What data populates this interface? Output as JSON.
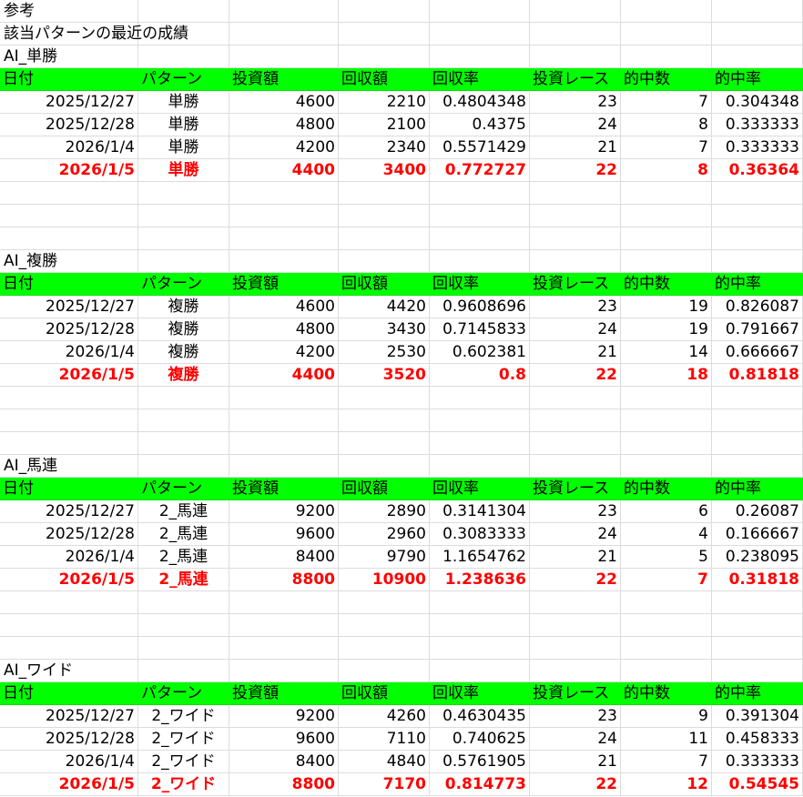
{
  "note": {
    "line1": "参考",
    "line2": "該当パターンの最近の成績"
  },
  "columns": [
    "日付",
    "パターン",
    "投資額",
    "回収額",
    "回収率",
    "投資レース",
    "的中数",
    "的中率"
  ],
  "sections": [
    {
      "title": "AI_単勝",
      "rows": [
        [
          "2025/12/27",
          "単勝",
          "4600",
          "2210",
          "0.4804348",
          "23",
          "7",
          "0.304348"
        ],
        [
          "2025/12/28",
          "単勝",
          "4800",
          "2100",
          "0.4375",
          "24",
          "8",
          "0.333333"
        ],
        [
          "2026/1/4",
          "単勝",
          "4200",
          "2340",
          "0.5571429",
          "21",
          "7",
          "0.333333"
        ],
        [
          "2026/1/5",
          "単勝",
          "4400",
          "3400",
          "0.772727",
          "22",
          "8",
          "0.36364"
        ]
      ]
    },
    {
      "title": "AI_複勝",
      "rows": [
        [
          "2025/12/27",
          "複勝",
          "4600",
          "4420",
          "0.9608696",
          "23",
          "19",
          "0.826087"
        ],
        [
          "2025/12/28",
          "複勝",
          "4800",
          "3430",
          "0.7145833",
          "24",
          "19",
          "0.791667"
        ],
        [
          "2026/1/4",
          "複勝",
          "4200",
          "2530",
          "0.602381",
          "21",
          "14",
          "0.666667"
        ],
        [
          "2026/1/5",
          "複勝",
          "4400",
          "3520",
          "0.8",
          "22",
          "18",
          "0.81818"
        ]
      ]
    },
    {
      "title": "AI_馬連",
      "rows": [
        [
          "2025/12/27",
          "2_馬連",
          "9200",
          "2890",
          "0.3141304",
          "23",
          "6",
          "0.26087"
        ],
        [
          "2025/12/28",
          "2_馬連",
          "9600",
          "2960",
          "0.3083333",
          "24",
          "4",
          "0.166667"
        ],
        [
          "2026/1/4",
          "2_馬連",
          "8400",
          "9790",
          "1.1654762",
          "21",
          "5",
          "0.238095"
        ],
        [
          "2026/1/5",
          "2_馬連",
          "8800",
          "10900",
          "1.238636",
          "22",
          "7",
          "0.31818"
        ]
      ]
    },
    {
      "title": "AI_ワイド",
      "rows": [
        [
          "2025/12/27",
          "2_ワイド",
          "9200",
          "4260",
          "0.4630435",
          "23",
          "9",
          "0.391304"
        ],
        [
          "2025/12/28",
          "2_ワイド",
          "9600",
          "7110",
          "0.740625",
          "24",
          "11",
          "0.458333"
        ],
        [
          "2026/1/4",
          "2_ワイド",
          "8400",
          "4840",
          "0.5761905",
          "21",
          "7",
          "0.333333"
        ],
        [
          "2026/1/5",
          "2_ワイド",
          "8800",
          "7170",
          "0.814773",
          "22",
          "12",
          "0.54545"
        ]
      ]
    }
  ],
  "colors": {
    "header_bg": "#00ff00",
    "latest_row_text": "#ff0000",
    "gridline": "#dcdcdc"
  }
}
